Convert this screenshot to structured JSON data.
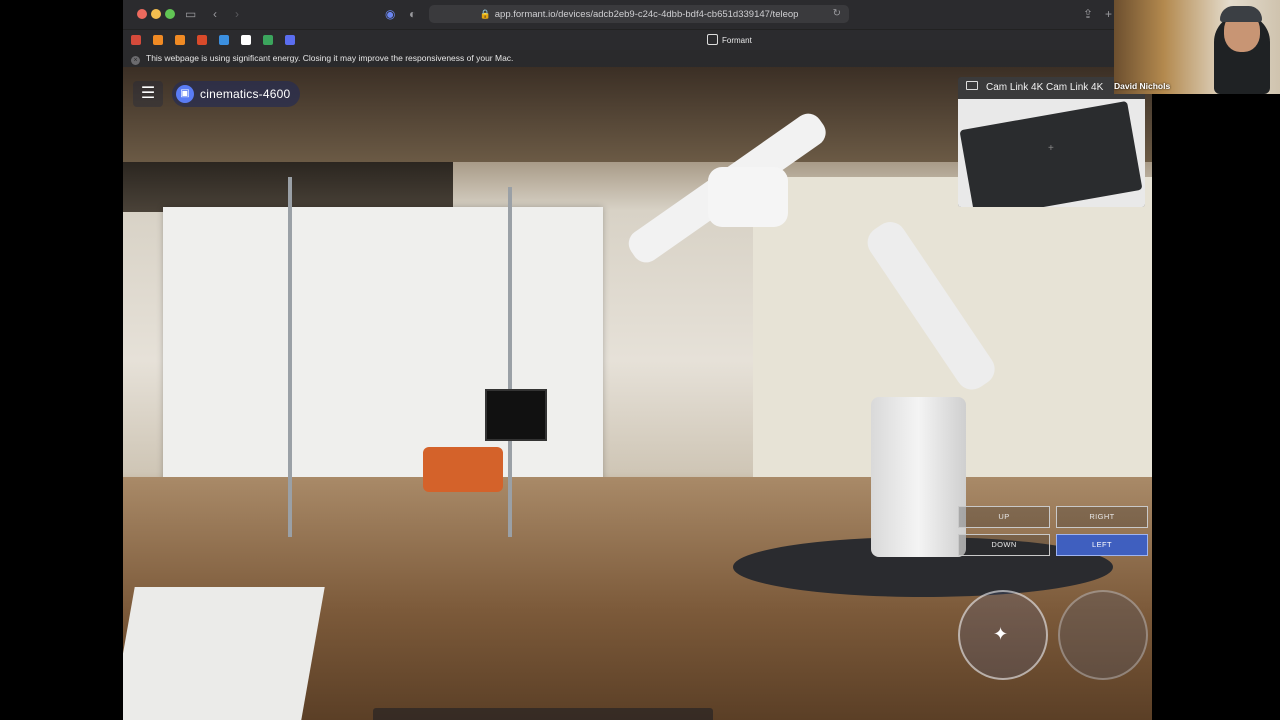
{
  "browser": {
    "url": "app.formant.io/devices/adcb2eb9-c24c-4dbb-bdf4-cb651d339147/teleop",
    "tab_title": "Formant",
    "energy_notice": "This webpage is using significant energy. Closing it may improve the responsiveness of your Mac.",
    "bookmark_colors": [
      "#d44a3b",
      "#f08a24",
      "#f08a24",
      "#d94a2a",
      "#3b8fe0",
      "#ffffff",
      "#3ba55d",
      "#5b6ef0"
    ]
  },
  "app": {
    "device_name": "cinematics-4600",
    "camera_panel_title": "Cam Link 4K Cam Link 4K",
    "controls": {
      "up": "UP",
      "right": "RIGHT",
      "down": "DOWN",
      "left": "LEFT"
    },
    "accent_color": "#3f5fbf"
  },
  "video_call": {
    "participant_name": "David Nichols"
  }
}
